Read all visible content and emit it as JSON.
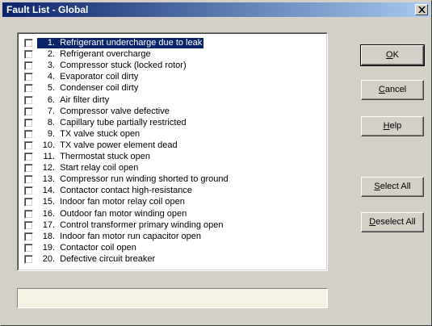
{
  "window": {
    "title": "Fault List - Global"
  },
  "fault_list": {
    "items": [
      {
        "num": "1.",
        "label": "Refrigerant undercharge due to leak",
        "checked": false,
        "selected": true
      },
      {
        "num": "2.",
        "label": "Refrigerant overcharge",
        "checked": false,
        "selected": false
      },
      {
        "num": "3.",
        "label": "Compressor stuck (locked rotor)",
        "checked": false,
        "selected": false
      },
      {
        "num": "4.",
        "label": "Evaporator coil dirty",
        "checked": false,
        "selected": false
      },
      {
        "num": "5.",
        "label": "Condenser coil dirty",
        "checked": false,
        "selected": false
      },
      {
        "num": "6.",
        "label": "Air filter dirty",
        "checked": false,
        "selected": false
      },
      {
        "num": "7.",
        "label": "Compressor valve defective",
        "checked": false,
        "selected": false
      },
      {
        "num": "8.",
        "label": "Capillary tube partially restricted",
        "checked": false,
        "selected": false
      },
      {
        "num": "9.",
        "label": "TX valve stuck open",
        "checked": false,
        "selected": false
      },
      {
        "num": "10.",
        "label": "TX valve power element dead",
        "checked": false,
        "selected": false
      },
      {
        "num": "11.",
        "label": "Thermostat stuck open",
        "checked": false,
        "selected": false
      },
      {
        "num": "12.",
        "label": "Start relay coil open",
        "checked": false,
        "selected": false
      },
      {
        "num": "13.",
        "label": "Compressor run winding shorted to ground",
        "checked": false,
        "selected": false
      },
      {
        "num": "14.",
        "label": "Contactor contact high-resistance",
        "checked": false,
        "selected": false
      },
      {
        "num": "15.",
        "label": "Indoor fan motor relay coil open",
        "checked": false,
        "selected": false
      },
      {
        "num": "16.",
        "label": "Outdoor fan motor winding open",
        "checked": false,
        "selected": false
      },
      {
        "num": "17.",
        "label": "Control transformer primary winding open",
        "checked": false,
        "selected": false
      },
      {
        "num": "18.",
        "label": "Indoor fan motor run capacitor open",
        "checked": false,
        "selected": false
      },
      {
        "num": "19.",
        "label": "Contactor coil open",
        "checked": false,
        "selected": false
      },
      {
        "num": "20.",
        "label": "Defective circuit breaker",
        "checked": false,
        "selected": false
      }
    ]
  },
  "buttons": {
    "ok": {
      "mnemonic": "O",
      "rest": "K"
    },
    "cancel": {
      "mnemonic": "C",
      "rest": "ancel"
    },
    "help": {
      "mnemonic": "H",
      "rest": "elp"
    },
    "select_all": {
      "mnemonic": "S",
      "rest": "elect All"
    },
    "deselect_all": {
      "mnemonic": "D",
      "rest": "eselect All"
    }
  },
  "status": {
    "text": ""
  },
  "colors": {
    "title_start": "#0a246a",
    "title_end": "#a6caf0",
    "face": "#d4d0c8",
    "selection": "#0a246a",
    "status_bg": "#f7f3e4"
  },
  "icons": {
    "close": "close-icon",
    "checkbox": "checkbox-unchecked"
  }
}
